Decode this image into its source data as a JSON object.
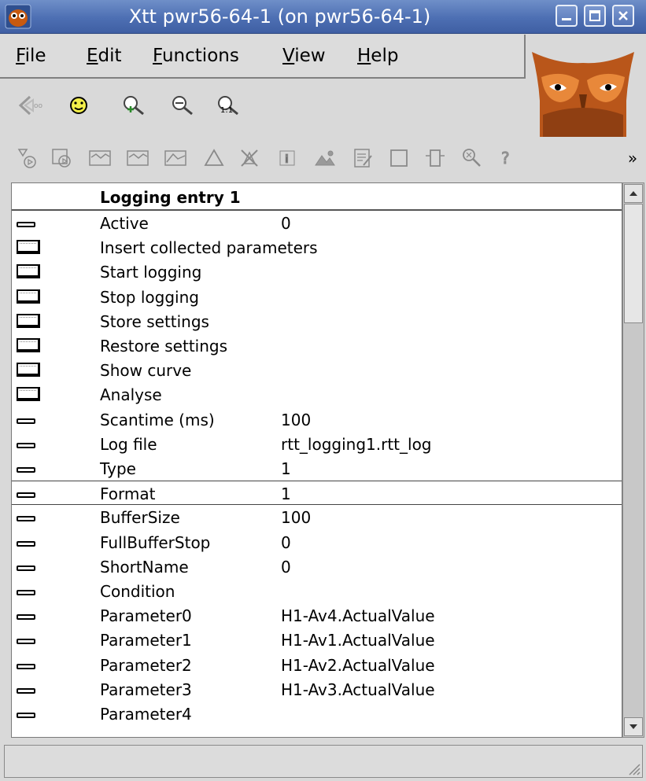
{
  "window": {
    "title": "Xtt pwr56-64-1 (on pwr56-64-1)"
  },
  "menu": [
    {
      "mnemonic": "F",
      "rest": "ile"
    },
    {
      "mnemonic": "E",
      "rest": "dit"
    },
    {
      "mnemonic": "F",
      "rest": "unctions"
    },
    {
      "mnemonic": "V",
      "rest": "iew"
    },
    {
      "mnemonic": "H",
      "rest": "elp"
    }
  ],
  "toolbar_overflow": "»",
  "list": {
    "header": "Logging entry 1",
    "rows": [
      {
        "type": "attr",
        "label": "Active",
        "value": "0"
      },
      {
        "type": "button",
        "label": "Insert collected parameters",
        "value": ""
      },
      {
        "type": "button",
        "label": "Start logging",
        "value": ""
      },
      {
        "type": "button",
        "label": "Stop logging",
        "value": ""
      },
      {
        "type": "button",
        "label": "Store settings",
        "value": ""
      },
      {
        "type": "button",
        "label": "Restore settings",
        "value": ""
      },
      {
        "type": "button",
        "label": "Show curve",
        "value": ""
      },
      {
        "type": "button",
        "label": "Analyse",
        "value": ""
      },
      {
        "type": "attr",
        "label": "Scantime (ms)",
        "value": "100"
      },
      {
        "type": "attr",
        "label": "Log file",
        "value": "rtt_logging1.rtt_log"
      },
      {
        "type": "attr",
        "label": "Type",
        "value": "1"
      },
      {
        "type": "attr",
        "label": "Format",
        "value": "1",
        "selected": true
      },
      {
        "type": "attr",
        "label": "BufferSize",
        "value": "100"
      },
      {
        "type": "attr",
        "label": "FullBufferStop",
        "value": "0"
      },
      {
        "type": "attr",
        "label": "ShortName",
        "value": "0"
      },
      {
        "type": "attr",
        "label": "Condition",
        "value": ""
      },
      {
        "type": "attr",
        "label": "Parameter0",
        "value": "H1-Av4.ActualValue"
      },
      {
        "type": "attr",
        "label": "Parameter1",
        "value": "H1-Av1.ActualValue"
      },
      {
        "type": "attr",
        "label": "Parameter2",
        "value": "H1-Av2.ActualValue"
      },
      {
        "type": "attr",
        "label": "Parameter3",
        "value": "H1-Av3.ActualValue"
      },
      {
        "type": "attr",
        "label": "Parameter4",
        "value": ""
      }
    ]
  },
  "statusbar": {
    "text": ""
  }
}
